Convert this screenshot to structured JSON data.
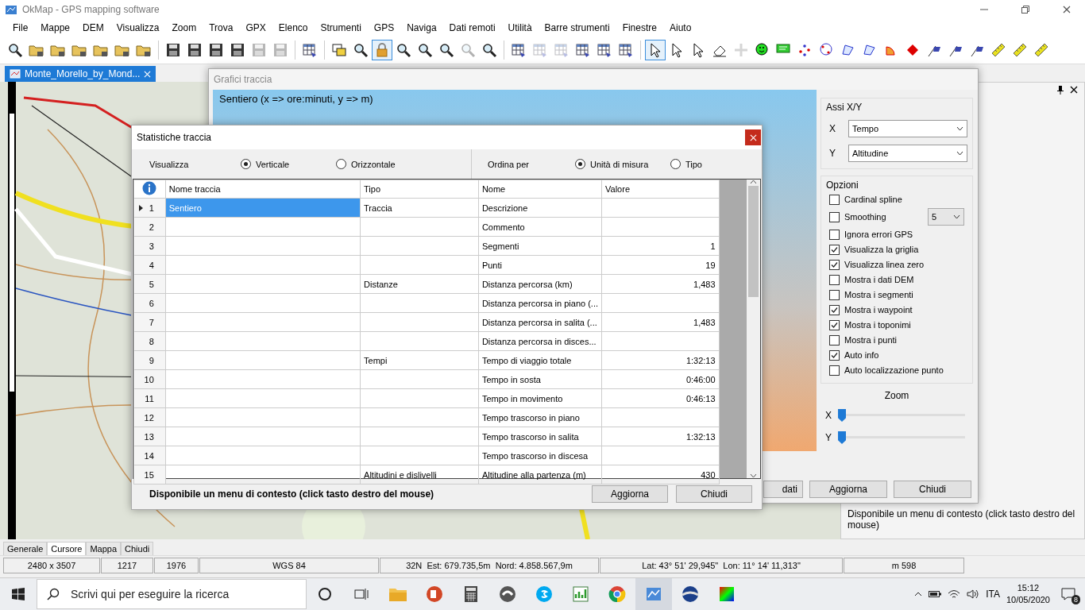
{
  "window": {
    "title": "OkMap - GPS mapping software"
  },
  "menu": [
    "File",
    "Mappe",
    "DEM",
    "Visualizza",
    "Zoom",
    "Trova",
    "GPX",
    "Elenco",
    "Strumenti",
    "GPS",
    "Naviga",
    "Dati remoti",
    "Utilità",
    "Barre strumenti",
    "Finestre",
    "Aiuto"
  ],
  "toolbar": [
    {
      "kind": "magnifier",
      "selected": false,
      "disabled": false
    },
    {
      "kind": "folder",
      "selected": false,
      "disabled": false
    },
    {
      "kind": "folder",
      "selected": false,
      "disabled": false
    },
    {
      "kind": "folder",
      "selected": false,
      "disabled": false
    },
    {
      "kind": "folder",
      "selected": false,
      "disabled": false
    },
    {
      "kind": "folder",
      "selected": false,
      "disabled": false
    },
    {
      "kind": "folder",
      "selected": false,
      "disabled": false
    },
    {
      "kind": "disk",
      "selected": false,
      "disabled": false
    },
    {
      "kind": "disk",
      "selected": false,
      "disabled": false
    },
    {
      "kind": "disk",
      "selected": false,
      "disabled": false
    },
    {
      "kind": "disk",
      "selected": false,
      "disabled": false
    },
    {
      "kind": "disk",
      "selected": false,
      "disabled": true
    },
    {
      "kind": "disk",
      "selected": false,
      "disabled": true
    },
    {
      "kind": "table",
      "selected": false,
      "disabled": false
    },
    {
      "kind": "windows",
      "selected": false,
      "disabled": false
    },
    {
      "kind": "magnifier",
      "selected": false,
      "disabled": false
    },
    {
      "kind": "lock",
      "selected": true,
      "disabled": false
    },
    {
      "kind": "magnifier",
      "selected": false,
      "disabled": false
    },
    {
      "kind": "magnifier",
      "selected": false,
      "disabled": false
    },
    {
      "kind": "magnifier",
      "selected": false,
      "disabled": false
    },
    {
      "kind": "magnifier",
      "selected": false,
      "disabled": true
    },
    {
      "kind": "magnifier",
      "selected": false,
      "disabled": false
    },
    {
      "kind": "table",
      "selected": false,
      "disabled": false
    },
    {
      "kind": "table",
      "selected": false,
      "disabled": true
    },
    {
      "kind": "table",
      "selected": false,
      "disabled": true
    },
    {
      "kind": "table",
      "selected": false,
      "disabled": false
    },
    {
      "kind": "table",
      "selected": false,
      "disabled": false
    },
    {
      "kind": "table",
      "selected": false,
      "disabled": false
    },
    {
      "kind": "pointer",
      "selected": true,
      "disabled": false
    },
    {
      "kind": "pointer",
      "selected": false,
      "disabled": false
    },
    {
      "kind": "pointer",
      "selected": false,
      "disabled": false
    },
    {
      "kind": "eraser",
      "selected": false,
      "disabled": false
    },
    {
      "kind": "crosshair",
      "selected": false,
      "disabled": true
    },
    {
      "kind": "smiley",
      "selected": false,
      "disabled": false
    },
    {
      "kind": "note",
      "selected": false,
      "disabled": false
    },
    {
      "kind": "points",
      "selected": false,
      "disabled": false
    },
    {
      "kind": "circle",
      "selected": false,
      "disabled": false
    },
    {
      "kind": "polygon",
      "selected": false,
      "disabled": false
    },
    {
      "kind": "polygon",
      "selected": false,
      "disabled": false
    },
    {
      "kind": "sector",
      "selected": false,
      "disabled": false
    },
    {
      "kind": "diamond",
      "selected": false,
      "disabled": false
    },
    {
      "kind": "flag",
      "selected": false,
      "disabled": false
    },
    {
      "kind": "flag",
      "selected": false,
      "disabled": false
    },
    {
      "kind": "flag",
      "selected": false,
      "disabled": false
    },
    {
      "kind": "ruler",
      "selected": false,
      "disabled": false
    },
    {
      "kind": "ruler",
      "selected": false,
      "disabled": false
    },
    {
      "kind": "ruler",
      "selected": false,
      "disabled": false
    }
  ],
  "document_tab": {
    "title": "Monte_Morello_by_Mond...",
    "selected": true
  },
  "side_panel": {
    "info": "Disponibile un menu di contesto (click tasto destro del mouse)"
  },
  "chart_window": {
    "title": "Grafici traccia",
    "chart_title": "Sentiero (x => ore:minuti, y => m)",
    "axes": {
      "group": "Assi X/Y",
      "rows": [
        {
          "label": "X",
          "value": "Tempo"
        },
        {
          "label": "Y",
          "value": "Altitudine"
        }
      ]
    },
    "options": {
      "group": "Opzioni",
      "items": [
        {
          "label": "Cardinal spline",
          "checked": false
        },
        {
          "label": "Smoothing",
          "checked": false,
          "select_value": "5"
        },
        {
          "label": "Ignora errori GPS",
          "checked": false
        },
        {
          "label": "Visualizza la griglia",
          "checked": true
        },
        {
          "label": "Visualizza linea zero",
          "checked": true
        },
        {
          "label": "Mostra i dati DEM",
          "checked": false
        },
        {
          "label": "Mostra i segmenti",
          "checked": false
        },
        {
          "label": "Mostra i waypoint",
          "checked": true
        },
        {
          "label": "Mostra i toponimi",
          "checked": true
        },
        {
          "label": "Mostra i punti",
          "checked": false
        },
        {
          "label": "Auto info",
          "checked": true
        },
        {
          "label": "Auto localizzazione punto",
          "checked": false
        }
      ]
    },
    "zoom": {
      "label": "Zoom",
      "sliders": [
        {
          "label": "X",
          "level": 0
        },
        {
          "label": "Y",
          "level": 0
        }
      ]
    },
    "buttons": [
      "dati",
      "Aggiorna",
      "Chiudi"
    ]
  },
  "stats_window": {
    "title": "Statistiche traccia",
    "view": {
      "label": "Visualizza",
      "options": [
        {
          "label": "Verticale",
          "selected": true
        },
        {
          "label": "Orizzontale",
          "selected": false
        }
      ]
    },
    "sort": {
      "label": "Ordina per",
      "options": [
        {
          "label": "Unità di misura",
          "selected": true
        },
        {
          "label": "Tipo",
          "selected": false
        }
      ]
    },
    "table": {
      "columns": [
        "Nome traccia",
        "Tipo",
        "Nome",
        "Valore"
      ],
      "rows": [
        {
          "number": "1",
          "track": "Sentiero",
          "type": "Traccia",
          "name": "Descrizione",
          "selected": true
        },
        {
          "number": "2",
          "name": "Commento",
          "selected": false
        },
        {
          "number": "3",
          "name": "Segmenti",
          "value": "1",
          "selected": false
        },
        {
          "number": "4",
          "name": "Punti",
          "value": "19",
          "selected": false
        },
        {
          "number": "5",
          "type": "Distanze",
          "name": "Distanza percorsa (km)",
          "value": "1,483",
          "selected": false
        },
        {
          "number": "6",
          "name": "Distanza percorsa in piano (...",
          "selected": false
        },
        {
          "number": "7",
          "name": "Distanza percorsa in salita (...",
          "value": "1,483",
          "selected": false
        },
        {
          "number": "8",
          "name": "Distanza percorsa in disces...",
          "selected": false
        },
        {
          "number": "9",
          "type": "Tempi",
          "name": "Tempo di viaggio totale",
          "value": "1:32:13",
          "selected": false
        },
        {
          "number": "10",
          "name": "Tempo in sosta",
          "value": "0:46:00",
          "selected": false
        },
        {
          "number": "11",
          "name": "Tempo in movimento",
          "value": "0:46:13",
          "selected": false
        },
        {
          "number": "12",
          "name": "Tempo trascorso in piano",
          "selected": false
        },
        {
          "number": "13",
          "name": "Tempo trascorso in salita",
          "value": "1:32:13",
          "selected": false
        },
        {
          "number": "14",
          "name": "Tempo trascorso in discesa",
          "selected": false
        },
        {
          "number": "15",
          "type": "Altitudini e dislivelli",
          "name": "Altitudine alla partenza (m)",
          "value": "430",
          "selected": false
        }
      ]
    },
    "footer_note": "Disponibile un menu di contesto (click tasto destro del mouse)",
    "buttons": [
      "Aggiorna",
      "Chiudi"
    ]
  },
  "bottom_tabs": [
    {
      "label": "Generale",
      "selected": false
    },
    {
      "label": "Cursore",
      "selected": true
    },
    {
      "label": "Mappa",
      "selected": false
    },
    {
      "label": "Chiudi",
      "selected": false
    }
  ],
  "status_bar": [
    "2480 x 3507",
    "1217",
    "1976",
    "WGS 84",
    "32N  Est: 679.735,5m  Nord: 4.858.567,9m",
    "Lat: 43° 51' 29,945\"  Lon: 11° 14' 11,313\"",
    "m 598"
  ],
  "taskbar": {
    "search_placeholder": "Scrivi qui per eseguire la ricerca",
    "language": "ITA",
    "time": "15:12",
    "date": "10/05/2020",
    "notifications": "8"
  }
}
